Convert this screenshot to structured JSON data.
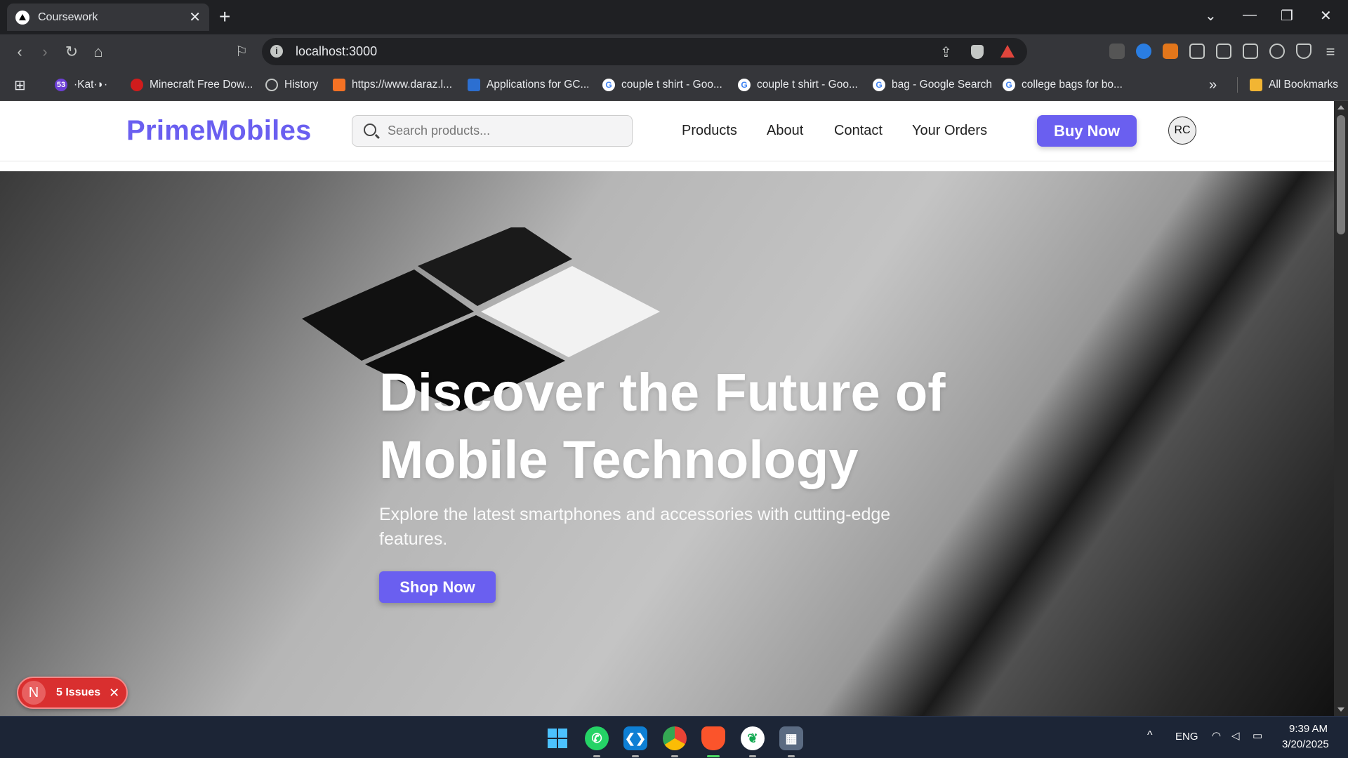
{
  "browser": {
    "tab_title": "Coursework",
    "address": "localhost:3000"
  },
  "bookmarks": [
    {
      "label": "·Kat·◗·",
      "badge": "53"
    },
    {
      "label": "Minecraft Free Dow..."
    },
    {
      "label": "History"
    },
    {
      "label": "https://www.daraz.l..."
    },
    {
      "label": "Applications for GC..."
    },
    {
      "label": "couple t shirt - Goo..."
    },
    {
      "label": "couple t shirt - Goo..."
    },
    {
      "label": "bag - Google Search"
    },
    {
      "label": "college bags for bo..."
    }
  ],
  "bookmarks_all": "All Bookmarks",
  "site": {
    "brand": "PrimeMobiles",
    "search_placeholder": "Search products...",
    "nav": [
      "Products",
      "About",
      "Contact",
      "Your Orders"
    ],
    "buy_now": "Buy Now",
    "avatar": "RC"
  },
  "hero": {
    "title": "Discover the Future of Mobile Technology",
    "subtitle": "Explore the latest smartphones and accessories with cutting-edge features.",
    "cta": "Shop Now"
  },
  "dev_badge": {
    "letter": "N",
    "issues": "5 Issues"
  },
  "taskbar": {
    "lang": "ENG",
    "time": "9:39 AM",
    "date": "3/20/2025"
  }
}
